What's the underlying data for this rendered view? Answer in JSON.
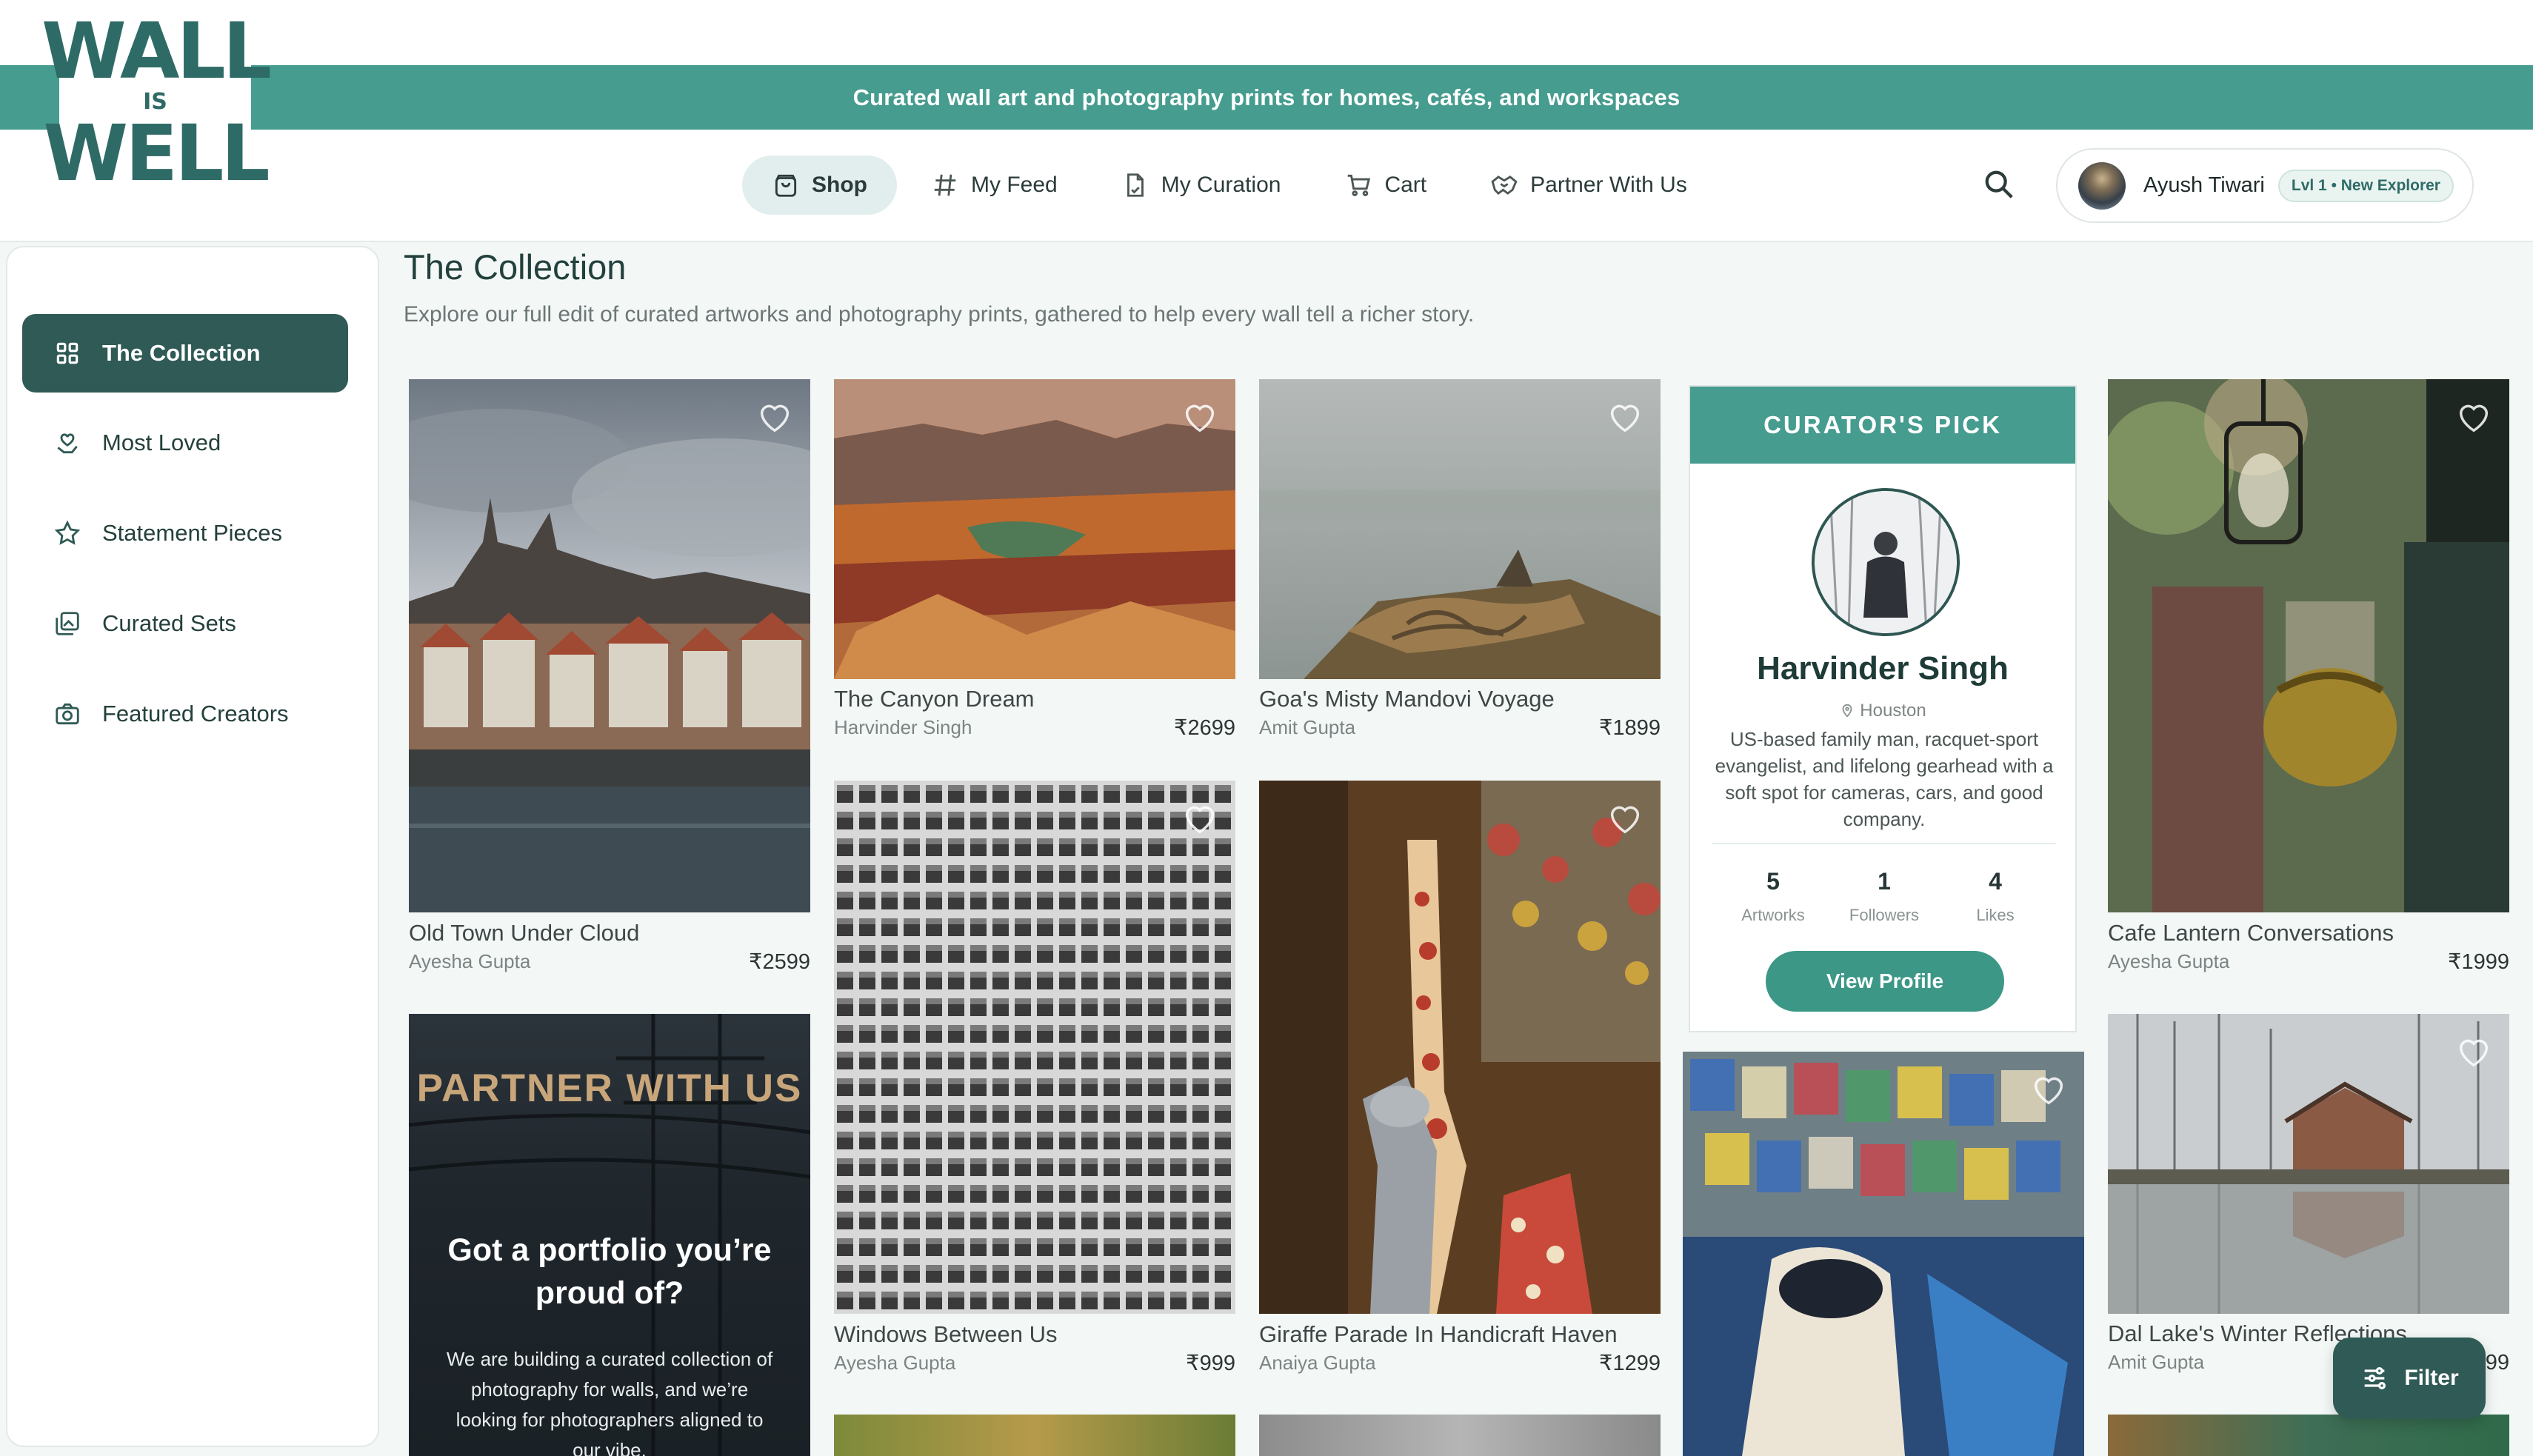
{
  "brand": {
    "logo_top": "WALL",
    "logo_mid": "IS",
    "logo_bottom": "WELL",
    "accent": "#459c8f",
    "dark": "#2f5a55"
  },
  "banner": "Curated wall art and photography prints for homes, cafés, and workspaces",
  "nav": [
    {
      "label": "Shop",
      "icon": "shopping-bag-icon",
      "active": true
    },
    {
      "label": "My Feed",
      "icon": "hash-icon"
    },
    {
      "label": "My Curation",
      "icon": "document-icon"
    },
    {
      "label": "Cart",
      "icon": "cart-icon"
    },
    {
      "label": "Partner With Us",
      "icon": "handshake-icon"
    }
  ],
  "user": {
    "name": "Ayush Tiwari",
    "level": "Lvl 1 • New Explorer"
  },
  "sidebar": [
    {
      "label": "The Collection",
      "icon": "grid-icon",
      "active": true
    },
    {
      "label": "Most Loved",
      "icon": "heart-hand-icon"
    },
    {
      "label": "Statement Pieces",
      "icon": "star-icon"
    },
    {
      "label": "Curated Sets",
      "icon": "gallery-icon"
    },
    {
      "label": "Featured Creators",
      "icon": "camera-icon"
    }
  ],
  "page": {
    "title": "The Collection",
    "subtitle": "Explore our full edit of curated artworks and photography prints, gathered to help every wall tell a richer story."
  },
  "artworks": [
    {
      "title": "Old Town Under Cloud",
      "author": "Ayesha Gupta",
      "price": "₹2599"
    },
    {
      "title": "The Canyon Dream",
      "author": "Harvinder Singh",
      "price": "₹2699"
    },
    {
      "title": "Goa's Misty Mandovi Voyage",
      "author": "Amit Gupta",
      "price": "₹1899"
    },
    {
      "title": "Cafe Lantern Conversations",
      "author": "Ayesha Gupta",
      "price": "₹1999"
    },
    {
      "title": "Windows Between Us",
      "author": "Ayesha Gupta",
      "price": "₹999"
    },
    {
      "title": "Giraffe Parade In Handicraft Haven",
      "author": "Anaiya Gupta",
      "price": "₹1299"
    },
    {
      "title": "Dal Lake's Winter Reflections",
      "author": "Amit Gupta",
      "price": "₹1399"
    }
  ],
  "curator": {
    "heading": "CURATOR'S PICK",
    "name": "Harvinder Singh",
    "location": "Houston",
    "bio": "US-based family man, racquet-sport evangelist, and lifelong gearhead with a soft spot for cameras, cars, and good company.",
    "stats": [
      {
        "value": "5",
        "label": "Artworks"
      },
      {
        "value": "1",
        "label": "Followers"
      },
      {
        "value": "4",
        "label": "Likes"
      }
    ],
    "button": "View Profile"
  },
  "partner": {
    "title": "PARTNER WITH US",
    "heading": "Got a portfolio you’re proud of?",
    "body": "We are building a curated collection of photography for walls, and we’re looking for photographers aligned to our vibe."
  },
  "filter_label": "Filter"
}
